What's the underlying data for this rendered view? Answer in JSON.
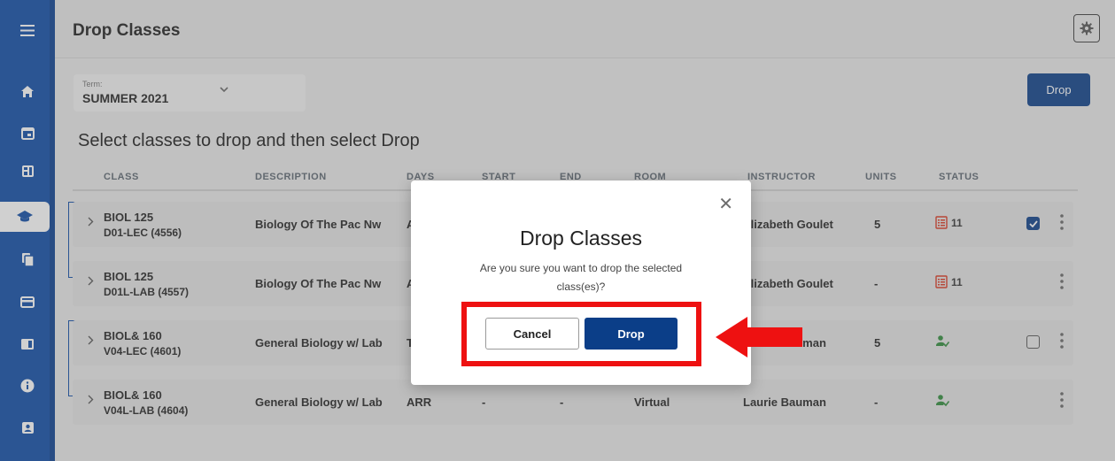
{
  "header": {
    "title": "Drop Classes",
    "settings_icon": "gear-icon"
  },
  "sidebar": {
    "items": [
      {
        "name": "menu",
        "icon": "hamburger-icon"
      },
      {
        "name": "home",
        "icon": "home-icon"
      },
      {
        "name": "calendar",
        "icon": "calendar-icon"
      },
      {
        "name": "dashboard",
        "icon": "dashboard-icon"
      },
      {
        "name": "academics",
        "icon": "graduation-cap-icon",
        "active": true
      },
      {
        "name": "documents",
        "icon": "documents-icon"
      },
      {
        "name": "payments",
        "icon": "credit-card-icon"
      },
      {
        "name": "records",
        "icon": "book-icon"
      },
      {
        "name": "info",
        "icon": "info-icon"
      },
      {
        "name": "profile",
        "icon": "profile-card-icon"
      }
    ]
  },
  "term": {
    "label": "Term:",
    "value": "SUMMER 2021"
  },
  "toolbar": {
    "drop_label": "Drop"
  },
  "instructions": "Select classes to drop and then select Drop",
  "table": {
    "columns": [
      "CLASS",
      "DESCRIPTION",
      "DAYS",
      "START",
      "END",
      "ROOM",
      "INSTRUCTOR",
      "UNITS",
      "STATUS"
    ],
    "rows": [
      {
        "class": "BIOL 125",
        "section": "D01-LEC (4556)",
        "description": "Biology Of The Pac Nw",
        "days": "A",
        "start": "",
        "end": "",
        "room": "",
        "instructor": "Elizabeth Goulet",
        "units": "5",
        "status_icon": "waitlist-icon",
        "status_count": "11",
        "checkbox": "checked"
      },
      {
        "class": "BIOL 125",
        "section": "D01L-LAB (4557)",
        "description": "Biology Of The Pac Nw",
        "days": "A",
        "start": "",
        "end": "",
        "room": "",
        "instructor": "Elizabeth Goulet",
        "units": "-",
        "status_icon": "waitlist-icon",
        "status_count": "11",
        "checkbox": "none"
      },
      {
        "class": "BIOL& 160",
        "section": "V04-LEC (4601)",
        "description": "General Biology w/ Lab",
        "days": "T",
        "start": "",
        "end": "",
        "room": "",
        "instructor": "Laurie Bauman",
        "units": "5",
        "status_icon": "enrolled-icon",
        "status_count": "",
        "checkbox": "unchecked"
      },
      {
        "class": "BIOL& 160",
        "section": "V04L-LAB (4604)",
        "description": "General Biology w/ Lab",
        "days": "ARR",
        "start": "-",
        "end": "-",
        "room": "Virtual",
        "instructor": "Laurie Bauman",
        "units": "-",
        "status_icon": "enrolled-icon",
        "status_count": "",
        "checkbox": "none"
      }
    ]
  },
  "modal": {
    "title": "Drop Classes",
    "message": "Are you sure you want to drop the selected class(es)?",
    "cancel_label": "Cancel",
    "drop_label": "Drop",
    "close_icon": "close-icon"
  },
  "colors": {
    "brand": "#0d4aa5",
    "button": "#0b3e88",
    "annotation": "#ee1111",
    "enrolled": "#2e8b3a",
    "waitlist": "#d9361e"
  }
}
